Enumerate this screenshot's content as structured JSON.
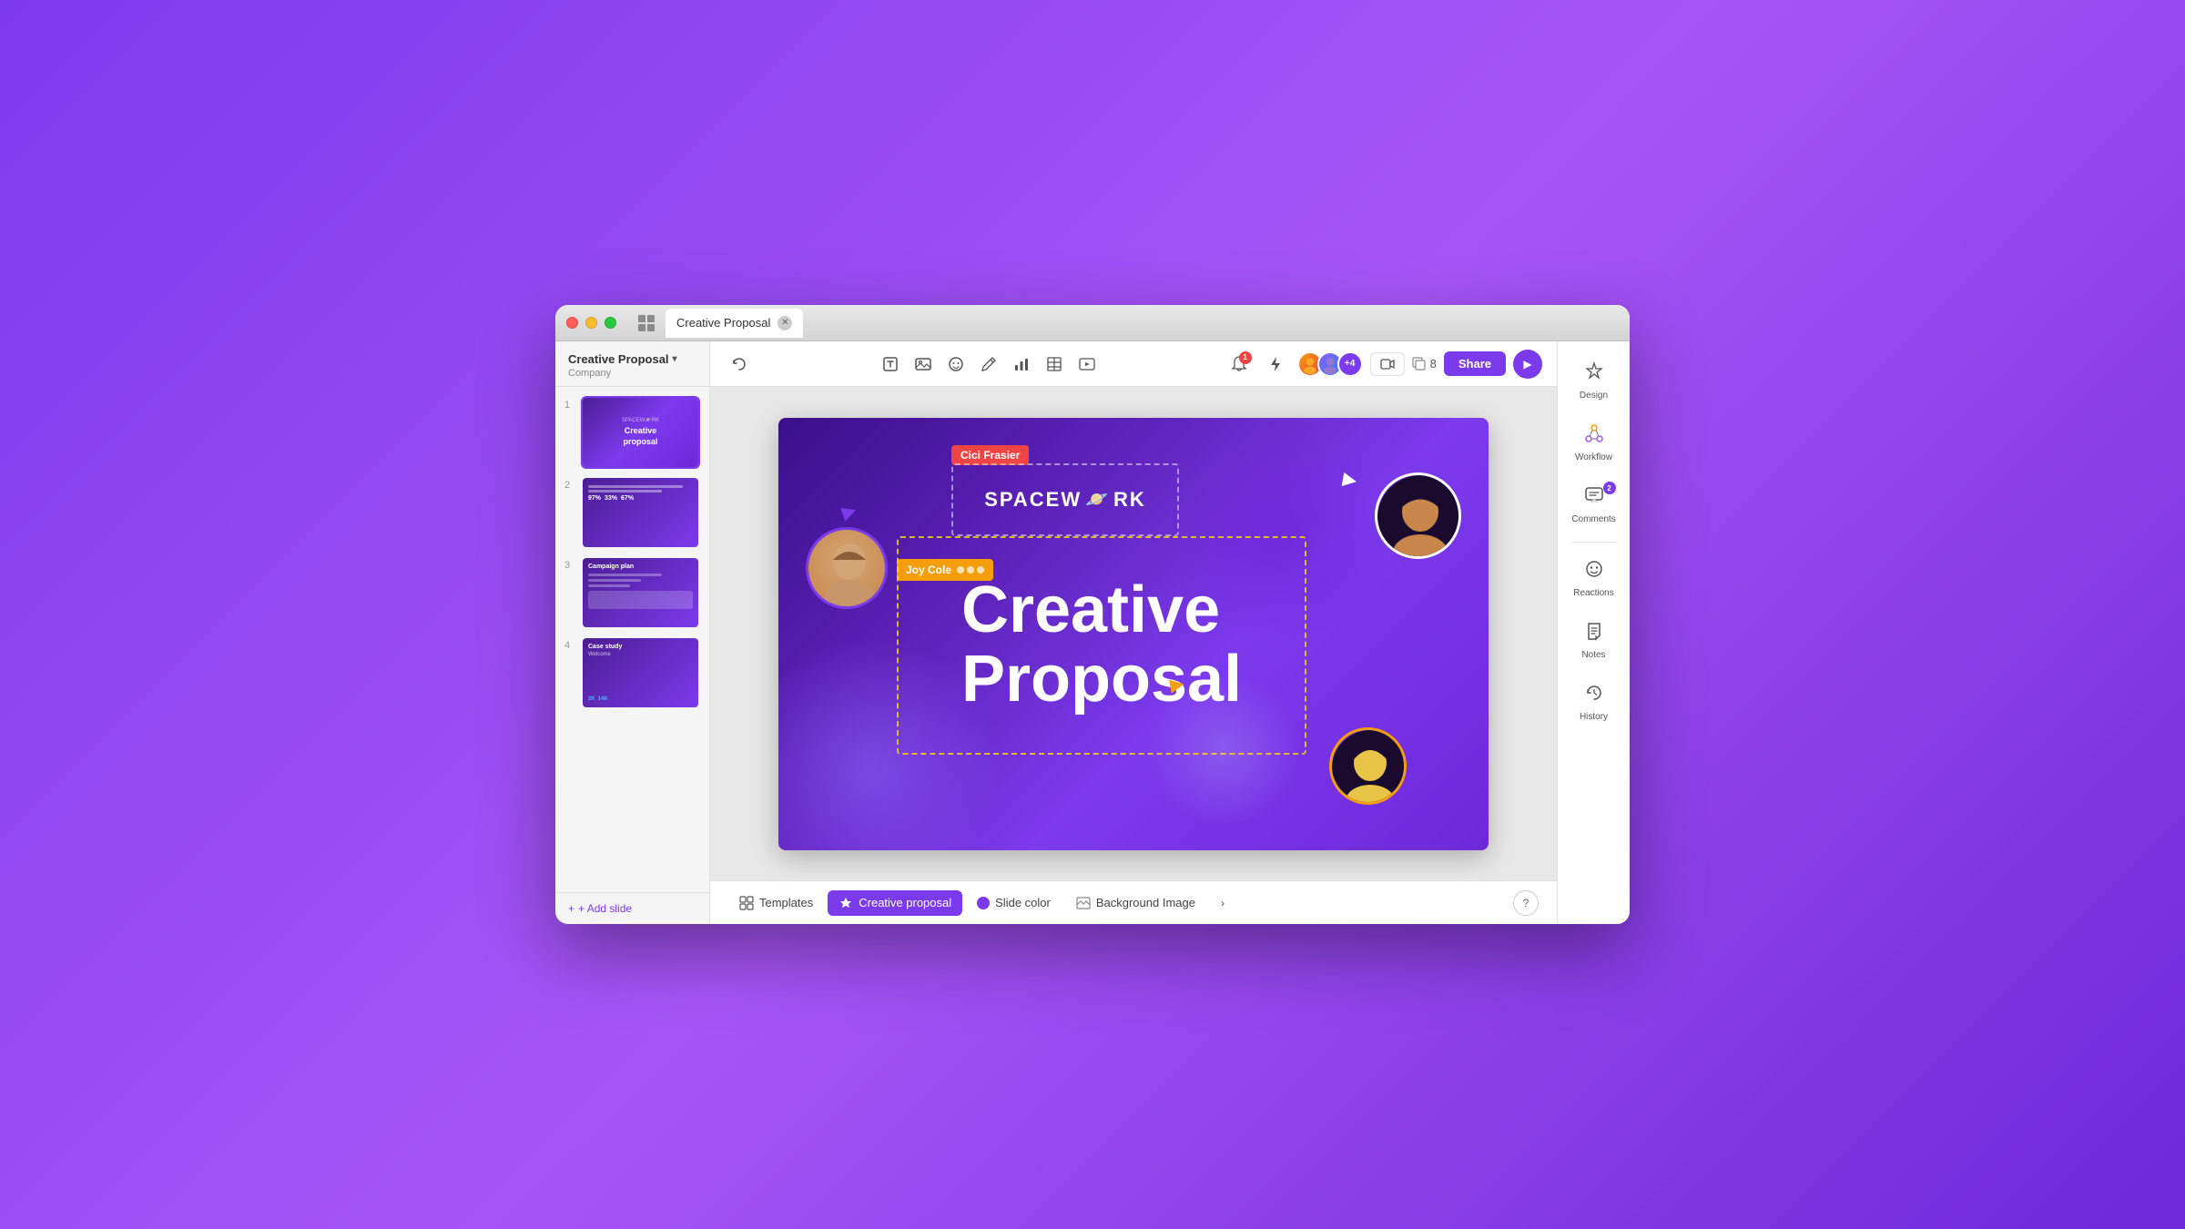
{
  "window": {
    "tab_title": "Creative Proposal",
    "traffic_lights": [
      "close",
      "minimize",
      "maximize"
    ]
  },
  "sidebar": {
    "title": "Creative Proposal",
    "subtitle": "Company",
    "add_slide_label": "+ Add slide",
    "slides": [
      {
        "number": "1",
        "type": "main"
      },
      {
        "number": "2",
        "type": "stats"
      },
      {
        "number": "3",
        "type": "campaign"
      },
      {
        "number": "4",
        "type": "case_study"
      }
    ]
  },
  "toolbar": {
    "undo_label": "↩",
    "tools": [
      {
        "name": "text-box-icon",
        "symbol": "⬜"
      },
      {
        "name": "image-icon",
        "symbol": "🖼"
      },
      {
        "name": "emoji-icon",
        "symbol": "😊"
      },
      {
        "name": "drawing-icon",
        "symbol": "✏️"
      },
      {
        "name": "chart-icon",
        "symbol": "📊"
      },
      {
        "name": "table-icon",
        "symbol": "⊞"
      },
      {
        "name": "embed-icon",
        "symbol": "▷"
      }
    ],
    "notification_count": "1",
    "lightning_icon": "⚡",
    "slides_count": "8",
    "share_label": "Share",
    "play_label": "▶"
  },
  "slide": {
    "logo_text": "SPACEW",
    "logo_planet": "🪐",
    "logo_suffix": "RK",
    "cici_label": "Cici Frasier",
    "joy_label": "Joy Cole",
    "proposal_title": "Creative\nProposal",
    "person1_initials": "👤",
    "person2_initials": "👤",
    "person3_initials": "👤"
  },
  "bottom_toolbar": {
    "templates_label": "Templates",
    "theme_label": "Creative proposal",
    "slide_color_label": "Slide color",
    "background_image_label": "Background Image",
    "help_label": "?"
  },
  "right_sidebar": {
    "tools": [
      {
        "name": "design",
        "icon": "✦",
        "label": "Design",
        "badge": null
      },
      {
        "name": "workflow",
        "icon": "⬡",
        "label": "Workflow",
        "badge": null
      },
      {
        "name": "comments",
        "icon": "💬",
        "label": "Comments",
        "badge": "2"
      },
      {
        "name": "reactions",
        "icon": "😊",
        "label": "Reactions",
        "badge": null
      },
      {
        "name": "notes",
        "icon": "📝",
        "label": "Notes",
        "badge": null
      },
      {
        "name": "history",
        "icon": "🕐",
        "label": "History",
        "badge": null
      }
    ]
  }
}
